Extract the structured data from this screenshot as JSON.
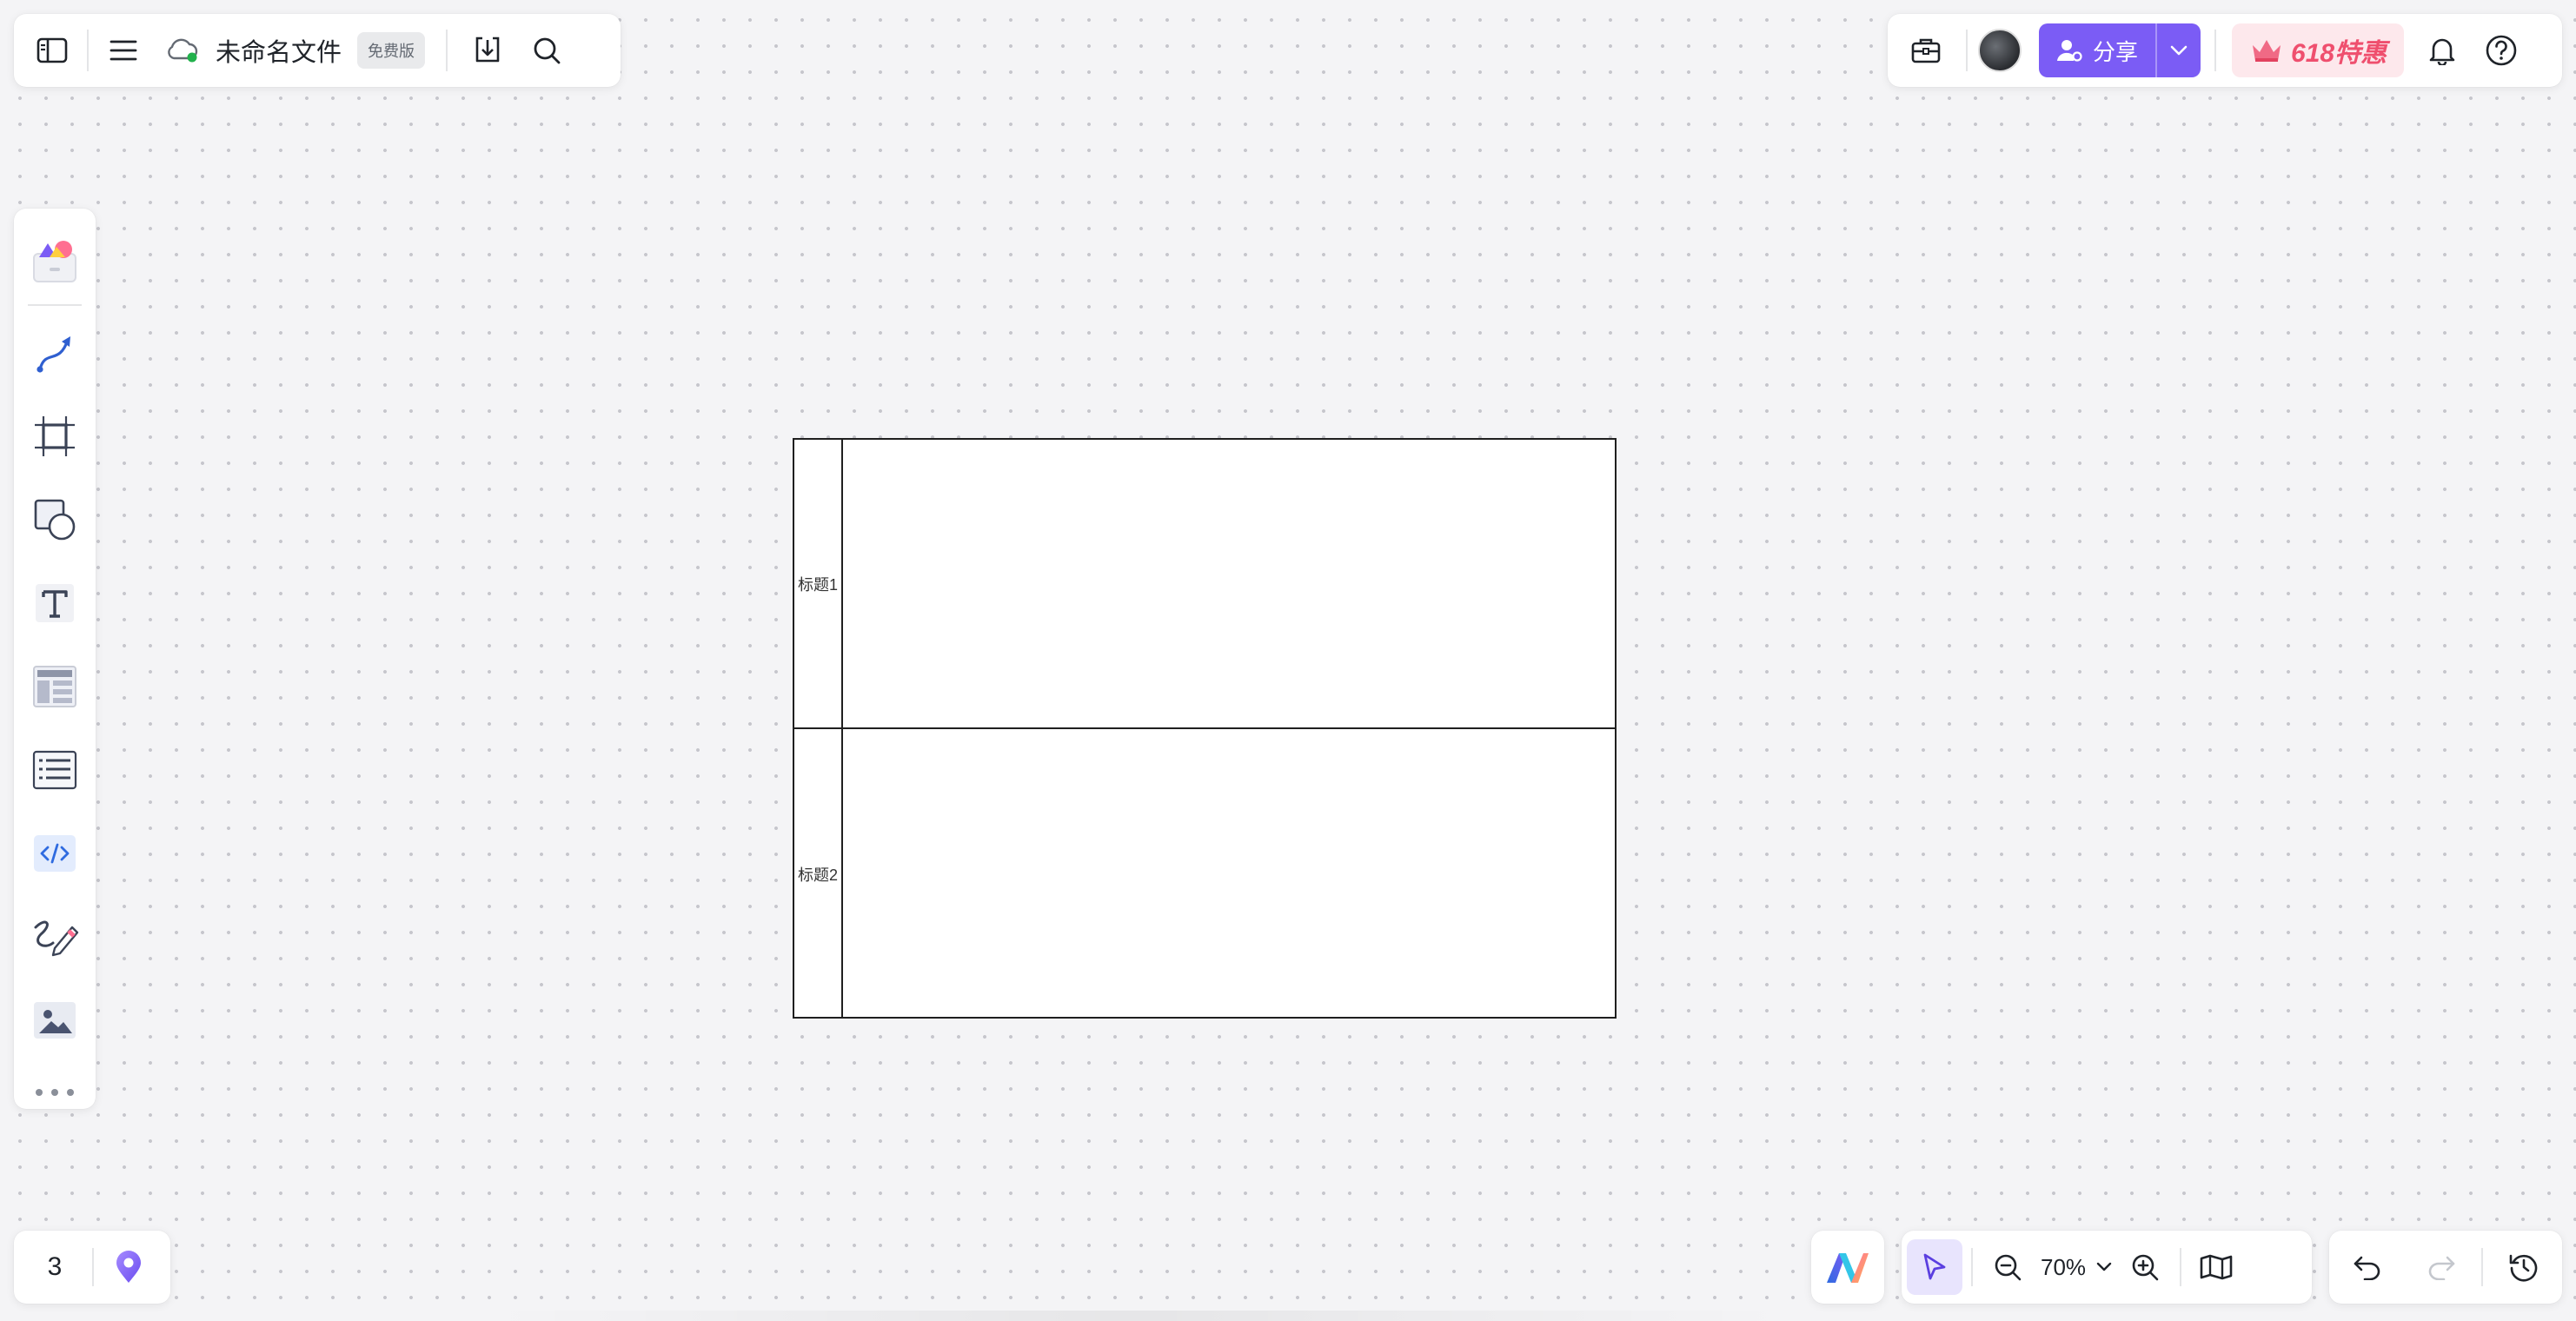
{
  "file": {
    "name": "未命名文件",
    "plan_badge": "免费版"
  },
  "header_right": {
    "share_label": "分享",
    "promo_label": "618特惠"
  },
  "canvas": {
    "lanes": [
      {
        "title": "标题1"
      },
      {
        "title": "标题2"
      }
    ]
  },
  "footer": {
    "page_number": "3",
    "zoom_level": "70%"
  },
  "icons": {
    "top_left": [
      "sidebar-toggle-icon",
      "menu-icon",
      "cloud-sync-icon",
      "download-icon",
      "search-icon"
    ],
    "top_right": [
      "toolbox-icon",
      "avatar",
      "share-user-icon",
      "chevron-down-icon",
      "crown-icon",
      "bell-icon",
      "help-icon"
    ],
    "left_tools": [
      "template-library-icon",
      "connector-icon",
      "frame-icon",
      "shape-icon",
      "text-icon",
      "table-layout-icon",
      "list-icon",
      "code-embed-icon",
      "pen-icon",
      "image-icon",
      "more-icon"
    ],
    "bottom": [
      "location-pin-icon",
      "ai-logo-icon",
      "select-cursor-icon",
      "zoom-out-icon",
      "zoom-in-icon",
      "map-icon",
      "undo-icon",
      "redo-icon",
      "history-icon"
    ]
  },
  "colors": {
    "accent": "#7b5cf5",
    "promo": "#ef4f6e",
    "canvas_bg": "#f4f4f6",
    "cloud_status": "#22b14c"
  }
}
